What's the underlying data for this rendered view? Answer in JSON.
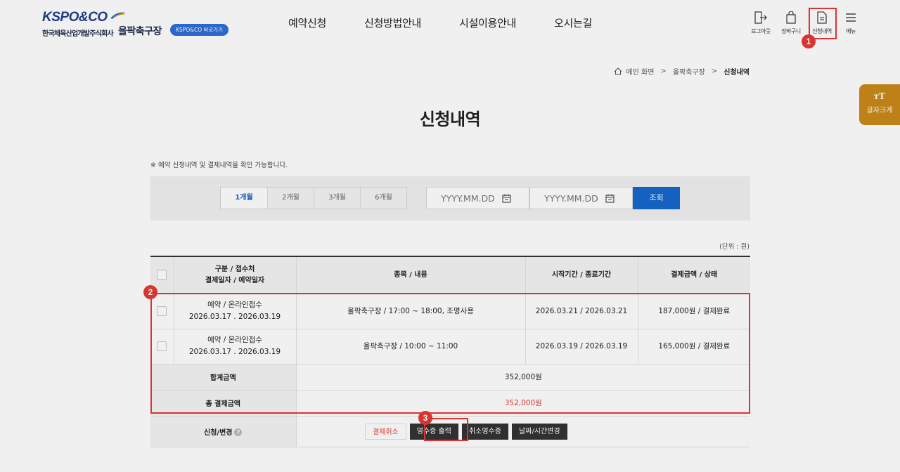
{
  "header": {
    "logo_text": "KSPO&CO",
    "org_name": "한국체육산업개발주식회사",
    "venue_name": "올팍축구장",
    "shortcut_label": "KSPO&CO 바로가기",
    "nav": [
      "예약신청",
      "신청방법안내",
      "시설이용안내",
      "오시는길"
    ],
    "utils": {
      "logout": "로그아웃",
      "cart": "장바구니",
      "history": "신청내역",
      "menu": "메뉴"
    }
  },
  "breadcrumb": {
    "home": "메인 화면",
    "level1": "올팍축구장",
    "current": "신청내역"
  },
  "font_size_tab": {
    "icon": "ᴛT",
    "label": "글자크게"
  },
  "page_title": "신청내역",
  "notice": "※ 예약 신청내역 및 결제내역을 확인 가능합니다.",
  "filter": {
    "periods": [
      "1개월",
      "2개월",
      "3개월",
      "6개월"
    ],
    "active_period": "1개월",
    "start_placeholder": "YYYY.MM.DD",
    "end_placeholder": "YYYY.MM.DD",
    "search_label": "조회"
  },
  "unit_label": "(단위 : 원)",
  "table": {
    "headers": {
      "type_line1": "구분 / 접수처",
      "type_line2": "결제일자 / 예약일자",
      "item": "종목 / 내용",
      "period": "시작기간 / 종료기간",
      "amount": "결제금액 / 상태"
    },
    "rows": [
      {
        "type": "예약 / 온라인접수",
        "dates": "2026.03.17 . 2026.03.19",
        "item": "올팍축구장 / 17:00 ~ 18:00, 조명사용",
        "period": "2026.03.21 /  2026.03.21",
        "amount": "187,000원 / 결제완료"
      },
      {
        "type": "예약 / 온라인접수",
        "dates": "2026.03.17 . 2026.03.19",
        "item": "올팍축구장 / 10:00 ~ 11:00",
        "period": "2026.03.19 /  2026.03.19",
        "amount": "165,000원 / 결제완료"
      }
    ],
    "subtotal_label": "합계금액",
    "subtotal_value": "352,000원",
    "total_label": "총 결제금액",
    "total_value": "352,000원",
    "action_label": "신청/변경",
    "actions": {
      "cancel": "결제취소",
      "receipt": "영수증 출력",
      "cancel_receipt": "취소영수증",
      "change": "날짜/시간변경"
    }
  },
  "annotations": [
    "1",
    "2",
    "3"
  ],
  "colors": {
    "brand_blue": "#1668cc",
    "highlight_red": "#e53935",
    "font_tab": "#c98a1a"
  }
}
